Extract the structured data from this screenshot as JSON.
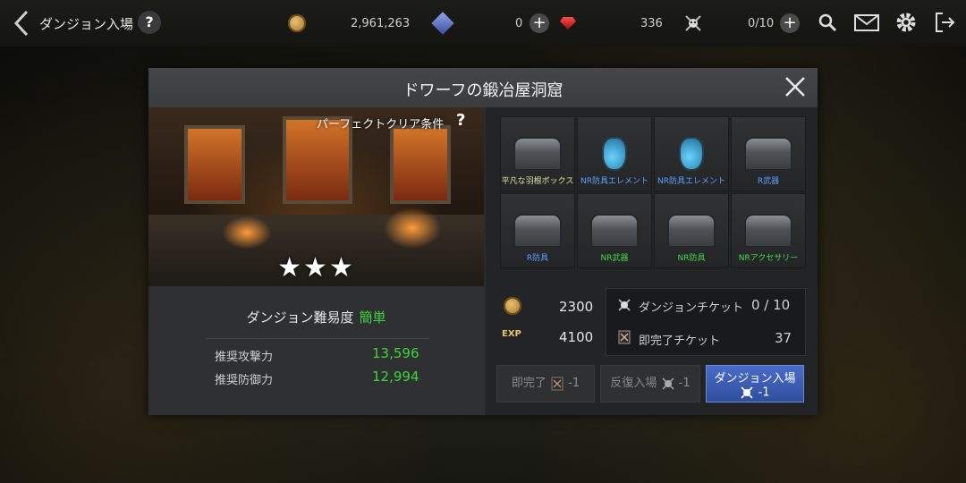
{
  "topbar": {
    "title": "ダンジョン入場",
    "help": "?",
    "gold": "2,961,263",
    "blue_gems": "0",
    "red_gems": "336",
    "tickets": "0/10"
  },
  "dialog": {
    "title": "ドワーフの鍛冶屋洞窟",
    "perfect_label": "パーフェクトクリア条件",
    "perfect_help": "?",
    "stars": "★★★",
    "difficulty_label": "ダンジョン難易度",
    "difficulty_value": "簡単",
    "stats": [
      {
        "label": "推奨攻撃力",
        "value": "13,596"
      },
      {
        "label": "推奨防御力",
        "value": "12,994"
      }
    ],
    "rewards": [
      {
        "label": "平凡な羽根ボックス",
        "type": "chest",
        "color": "white"
      },
      {
        "label": "NR防具エレメント",
        "type": "potion",
        "color": "blue"
      },
      {
        "label": "NR防具エレメント",
        "type": "potion",
        "color": "blue"
      },
      {
        "label": "R武器",
        "type": "chest",
        "color": "blue"
      },
      {
        "label": "R防具",
        "type": "chest",
        "color": "blue"
      },
      {
        "label": "NR武器",
        "type": "chest",
        "color": "green"
      },
      {
        "label": "NR防具",
        "type": "chest",
        "color": "green"
      },
      {
        "label": "NRアクセサリー",
        "type": "chest",
        "color": "green"
      }
    ],
    "gold_reward": "2300",
    "exp_label": "EXP",
    "exp_reward": "4100",
    "dungeon_ticket_label": "ダンジョンチケット",
    "dungeon_ticket_value": "0 / 10",
    "instant_ticket_label": "即完了チケット",
    "instant_ticket_value": "37",
    "buttons": {
      "instant_label": "即完了",
      "instant_cost": "-1",
      "repeat_label": "反復入場",
      "repeat_cost": "-1",
      "enter_label": "ダンジョン入場",
      "enter_cost": "-1"
    }
  }
}
